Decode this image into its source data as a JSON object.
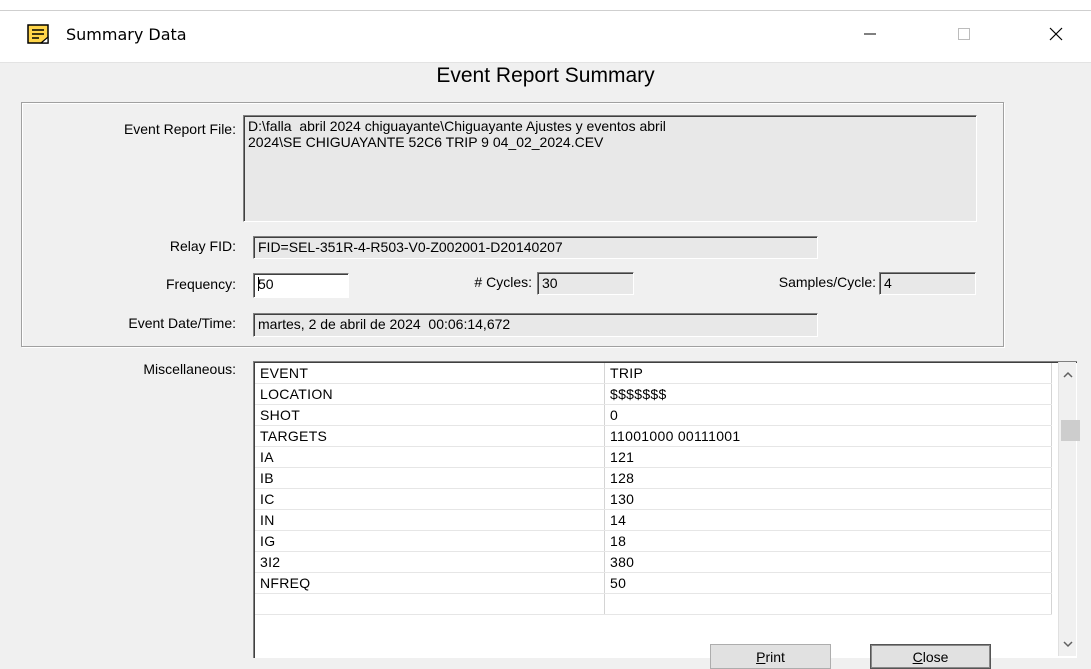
{
  "window": {
    "title": "Summary Data",
    "icon": "note-icon",
    "controls": {
      "minimize": "—",
      "maximize": "☐",
      "close": "✕"
    }
  },
  "heading": "Event Report Summary",
  "fields": {
    "event_report_file": {
      "label": "Event Report File:",
      "value": "D:\\falla  abril 2024 chiguayante\\Chiguayante Ajustes y eventos abril\n2024\\SE CHIGUAYANTE 52C6 TRIP 9 04_02_2024.CEV"
    },
    "relay_fid": {
      "label": "Relay FID:",
      "value": "FID=SEL-351R-4-R503-V0-Z002001-D20140207"
    },
    "frequency": {
      "label": "Frequency:",
      "value": "50"
    },
    "cycles": {
      "label": "# Cycles:",
      "value": "30"
    },
    "samples_cycle": {
      "label": "Samples/Cycle:",
      "value": "4"
    },
    "event_datetime": {
      "label": "Event Date/Time:",
      "value": "martes, 2 de abril de 2024  00:06:14,672"
    }
  },
  "misc": {
    "label": "Miscellaneous:",
    "rows": [
      [
        "EVENT",
        "TRIP"
      ],
      [
        "LOCATION",
        "$$$$$$$"
      ],
      [
        "SHOT",
        "0"
      ],
      [
        "TARGETS",
        "11001000 00111001"
      ],
      [
        "IA",
        "121"
      ],
      [
        "IB",
        "128"
      ],
      [
        "IC",
        "130"
      ],
      [
        "IN",
        "14"
      ],
      [
        "IG",
        "18"
      ],
      [
        "3I2",
        "380"
      ],
      [
        "NFREQ",
        "50"
      ],
      [
        "",
        ""
      ]
    ]
  },
  "buttons": {
    "print": {
      "mnemonic": "P",
      "rest": "rint"
    },
    "close": {
      "mnemonic": "C",
      "rest": "lose"
    }
  }
}
